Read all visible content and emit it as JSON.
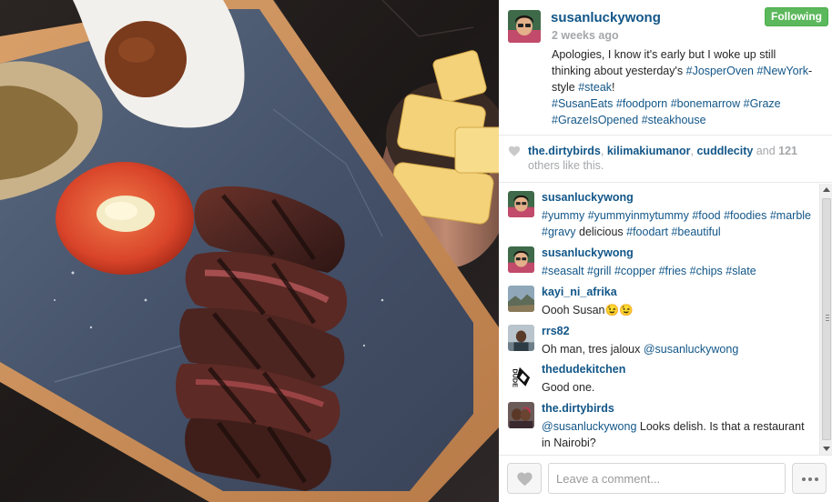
{
  "post": {
    "owner": "susanluckywong",
    "follow_label": "Following",
    "time_ago": "2 weeks ago",
    "caption": [
      {
        "t": "Apologies, I know it's early but I woke up still thinking about yesterday's ",
        "tag": false
      },
      {
        "t": "#JosperOven",
        "tag": true
      },
      {
        "t": " ",
        "tag": false
      },
      {
        "t": "#NewYork",
        "tag": true
      },
      {
        "t": "-style ",
        "tag": false
      },
      {
        "t": "#steak",
        "tag": true
      },
      {
        "t": "!",
        "tag": false
      },
      {
        "br": true
      },
      {
        "t": "#SusanEats",
        "tag": true
      },
      {
        "t": " ",
        "tag": false
      },
      {
        "t": "#foodporn",
        "tag": true
      },
      {
        "t": " ",
        "tag": false
      },
      {
        "t": "#bonemarrow",
        "tag": true
      },
      {
        "t": " ",
        "tag": false
      },
      {
        "t": "#Graze",
        "tag": true
      },
      {
        "t": " ",
        "tag": false
      },
      {
        "t": "#GrazeIsOpened",
        "tag": true
      },
      {
        "t": " ",
        "tag": false
      },
      {
        "t": "#steakhouse",
        "tag": true
      }
    ]
  },
  "likes": {
    "users": [
      "the.dirtybirds",
      "kilimakiumanor",
      "cuddlecity"
    ],
    "and_text": " and ",
    "count": "121",
    "others_text": " others like this."
  },
  "comments": [
    {
      "user": "susanluckywong",
      "avatar": "selfie-woman",
      "parts": [
        {
          "t": "#yummy",
          "tag": true
        },
        {
          "t": " "
        },
        {
          "t": "#yummyinmytummy",
          "tag": true
        },
        {
          "t": " "
        },
        {
          "t": "#food",
          "tag": true
        },
        {
          "t": " "
        },
        {
          "t": "#foodies",
          "tag": true
        },
        {
          "t": " "
        },
        {
          "t": "#marble",
          "tag": true
        },
        {
          "t": " "
        },
        {
          "t": "#gravy",
          "tag": true
        },
        {
          "t": " delicious "
        },
        {
          "t": "#foodart",
          "tag": true
        },
        {
          "t": " "
        },
        {
          "t": "#beautiful",
          "tag": true
        }
      ]
    },
    {
      "user": "susanluckywong",
      "avatar": "selfie-woman",
      "parts": [
        {
          "t": "#seasalt",
          "tag": true
        },
        {
          "t": " "
        },
        {
          "t": "#grill",
          "tag": true
        },
        {
          "t": " "
        },
        {
          "t": "#copper",
          "tag": true
        },
        {
          "t": " "
        },
        {
          "t": "#fries",
          "tag": true
        },
        {
          "t": " "
        },
        {
          "t": "#chips",
          "tag": true
        },
        {
          "t": " "
        },
        {
          "t": "#slate",
          "tag": true
        }
      ]
    },
    {
      "user": "kayi_ni_afrika",
      "avatar": "landscape",
      "parts": [
        {
          "t": "Oooh Susan😉😉"
        }
      ]
    },
    {
      "user": "rrs82",
      "avatar": "portrait",
      "parts": [
        {
          "t": "Oh man, tres jaloux "
        },
        {
          "t": "@susanluckywong",
          "tag": true
        }
      ]
    },
    {
      "user": "thedudekitchen",
      "avatar": "dude-logo",
      "parts": [
        {
          "t": "Good one."
        }
      ]
    },
    {
      "user": "the.dirtybirds",
      "avatar": "couple",
      "parts": [
        {
          "t": "@susanluckywong",
          "tag": true
        },
        {
          "t": " Looks delish. Is that a restaurant in Nairobi?"
        }
      ]
    }
  ],
  "footer": {
    "comment_placeholder": "Leave a comment..."
  },
  "colors": {
    "link": "#125688",
    "follow_green": "#5cb85c",
    "muted": "#a5a7aa"
  },
  "icons": {
    "heart": "heart-icon",
    "more": "ellipsis-icon"
  }
}
